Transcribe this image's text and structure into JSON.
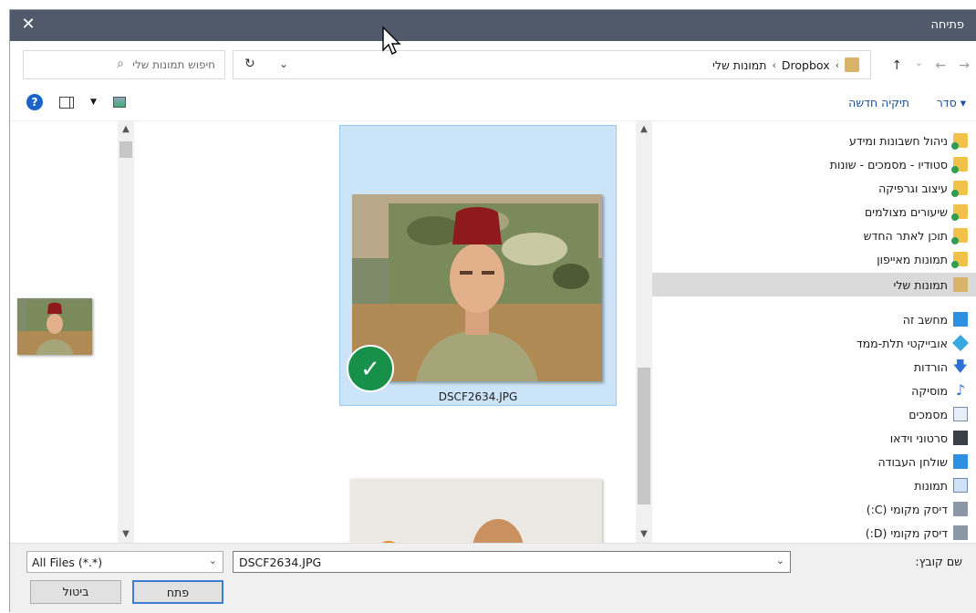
{
  "window": {
    "title": "פתיחה",
    "close_glyph": "✕"
  },
  "address": {
    "crumbs": [
      "Dropbox",
      "תמונות שלי"
    ],
    "separator": "›",
    "back_glyph": "←",
    "forward_glyph": "→",
    "recent_glyph": "⌄",
    "up_glyph": "↑",
    "dropdown_glyph": "⌄",
    "refresh_glyph": "↻"
  },
  "search": {
    "placeholder": "חיפוש תמונות שלי",
    "icon": "search-icon"
  },
  "toolbar": {
    "organize": "סדר ▾",
    "new_folder": "תיקיה חדשה",
    "help": "?"
  },
  "nav": {
    "items": [
      {
        "label": "ניהול חשבונות ומידע",
        "icon": "folder-sync-icon"
      },
      {
        "label": "סטודיו - מסמכים - שונות",
        "icon": "folder-sync-icon"
      },
      {
        "label": "עיצוב וגרפיקה",
        "icon": "folder-sync-icon"
      },
      {
        "label": "שיעורים מצולמים",
        "icon": "folder-sync-icon"
      },
      {
        "label": "תוכן לאתר החדש",
        "icon": "folder-sync-icon"
      },
      {
        "label": "תמונות מאייפון",
        "icon": "folder-sync-icon"
      },
      {
        "label": "תמונות שלי",
        "icon": "user-folder-icon",
        "selected": true
      },
      {
        "label": "מחשב זה",
        "icon": "computer-icon"
      },
      {
        "label": "אובייקטי תלת-ממד",
        "icon": "3d-objects-icon"
      },
      {
        "label": "הורדות",
        "icon": "downloads-icon"
      },
      {
        "label": "מוסיקה",
        "icon": "music-icon"
      },
      {
        "label": "מסמכים",
        "icon": "documents-icon"
      },
      {
        "label": "סרטוני וידאו",
        "icon": "videos-icon"
      },
      {
        "label": "שולחן העבודה",
        "icon": "desktop-icon"
      },
      {
        "label": "תמונות",
        "icon": "pictures-icon"
      },
      {
        "label": "דיסק מקומי (C:)",
        "icon": "drive-icon"
      },
      {
        "label": "דיסק מקומי (D:)",
        "icon": "drive-icon"
      }
    ]
  },
  "files": [
    {
      "name": "DSCF2634.JPG",
      "selected": true
    }
  ],
  "bottom": {
    "filename_label": "שם קובץ:",
    "filename_value": "DSCF2634.JPG",
    "filetype_value": "All Files (*.*)",
    "open_label": "פתח",
    "cancel_label": "ביטול"
  },
  "colors": {
    "titlebar": "#505a6b",
    "selection": "#cce4f7",
    "accent": "#1a4fa0",
    "check": "#17904a"
  }
}
